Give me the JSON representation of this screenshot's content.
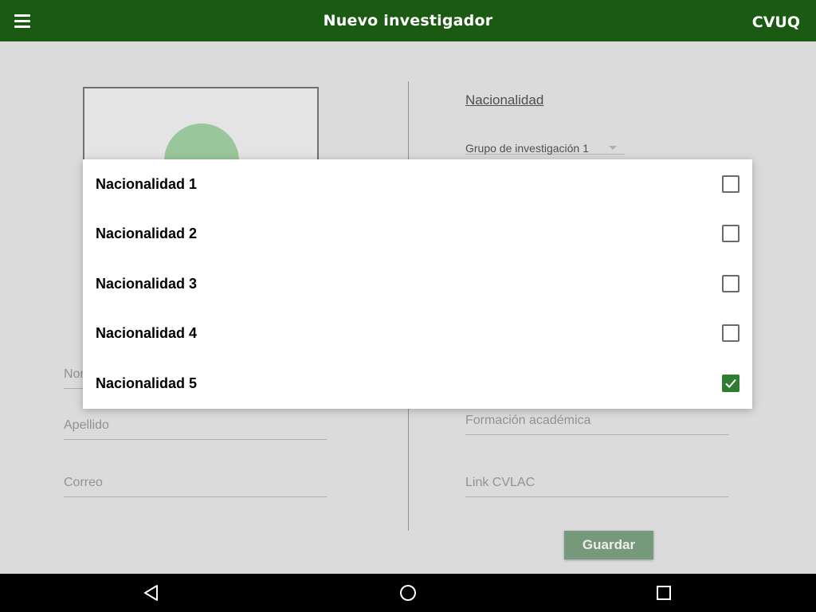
{
  "appbar": {
    "title": "Nuevo investigador",
    "brand": "CVUQ",
    "menu_icon": "hamburger-menu-icon",
    "background_color": "#1b5a12"
  },
  "form": {
    "nombre_placeholder": "Nombre",
    "apellido_placeholder": "Apellido",
    "correo_placeholder": "Correo",
    "nacionalidad_link": "Nacionalidad",
    "grupo_selected": "Grupo de investigación 1",
    "formacion_placeholder": "Formación académica",
    "cvlac_placeholder": "Link CVLAC",
    "guardar_label": "Guardar",
    "avatar_color": "#a5d6a7",
    "button_color": "#7ea584"
  },
  "dialog": {
    "options": [
      {
        "label": "Nacionalidad 1",
        "checked": false
      },
      {
        "label": "Nacionalidad 2",
        "checked": false
      },
      {
        "label": "Nacionalidad 3",
        "checked": false
      },
      {
        "label": "Nacionalidad 4",
        "checked": false
      },
      {
        "label": "Nacionalidad 5",
        "checked": true
      }
    ],
    "check_color": "#2e7d32"
  },
  "navbar": {
    "back_icon": "back-triangle-icon",
    "home_icon": "home-circle-icon",
    "recents_icon": "recents-square-icon"
  }
}
